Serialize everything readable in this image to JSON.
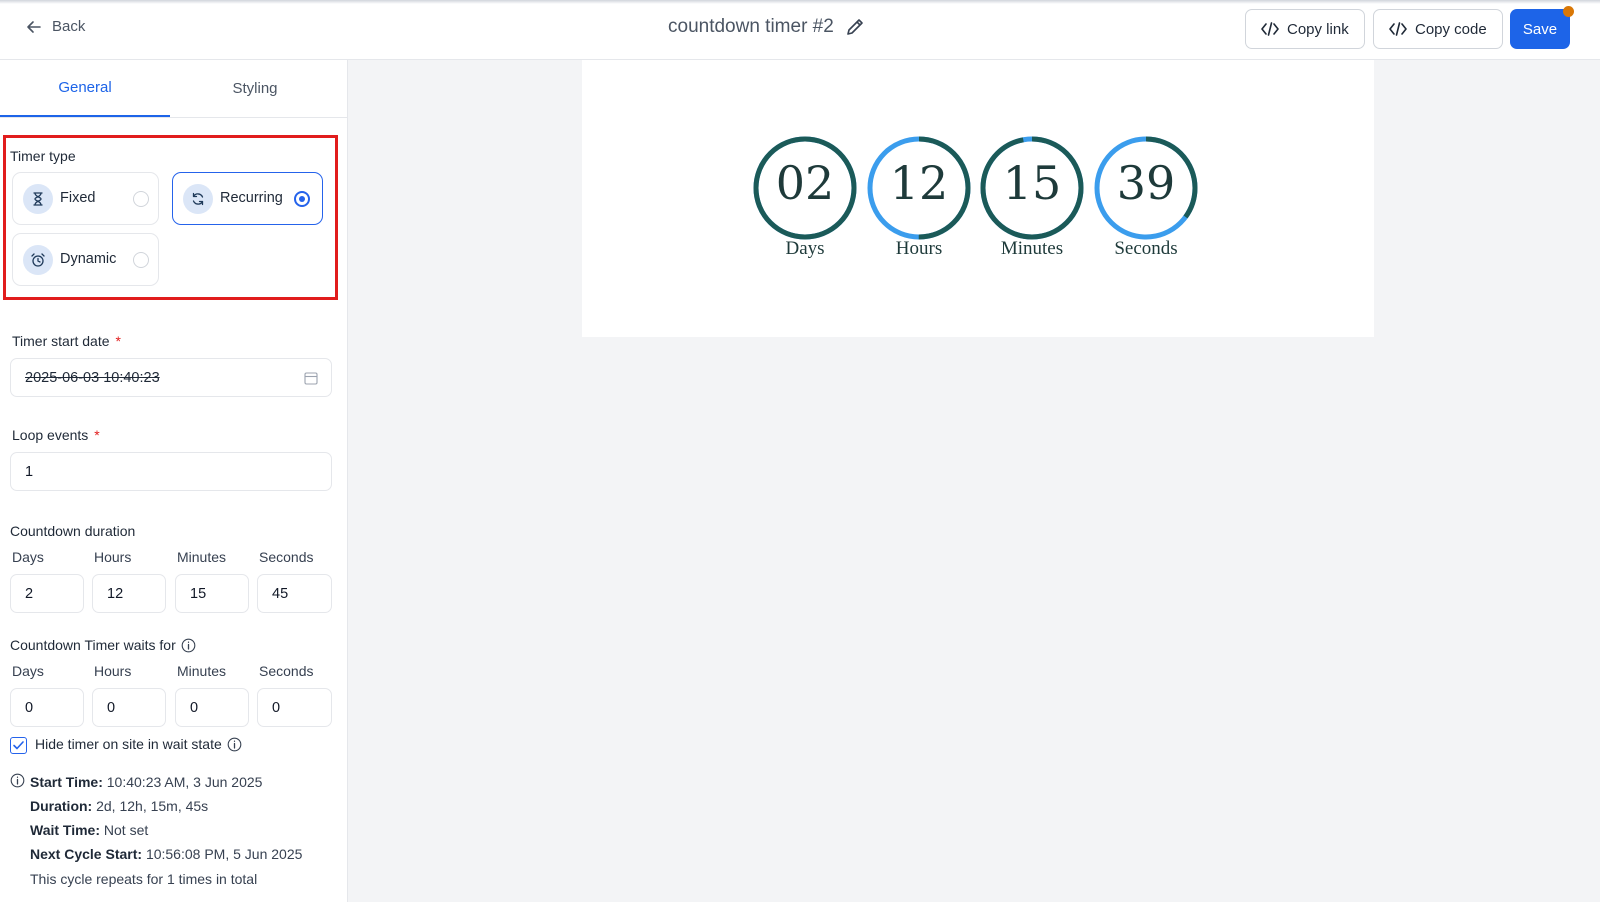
{
  "header": {
    "back_label": "Back",
    "title": "countdown timer #2",
    "copy_link_label": "Copy link",
    "copy_code_label": "Copy code",
    "save_label": "Save",
    "accent_color": "#1d64e8"
  },
  "tabs": [
    {
      "label": "General",
      "active": true
    },
    {
      "label": "Styling",
      "active": false
    }
  ],
  "timer_type": {
    "label": "Timer type",
    "options": [
      {
        "label": "Fixed",
        "icon": "hourglass-icon",
        "selected": false
      },
      {
        "label": "Recurring",
        "icon": "refresh-icon",
        "selected": true
      },
      {
        "label": "Dynamic",
        "icon": "alarm-clock-icon",
        "selected": false
      }
    ]
  },
  "start_date": {
    "label": "Timer start date",
    "required_mark": "*",
    "value": "2025-06-03 10:40:23"
  },
  "loop_events": {
    "label": "Loop events",
    "required_mark": "*",
    "value": "1"
  },
  "countdown_duration": {
    "label": "Countdown duration",
    "fields": [
      {
        "label": "Days",
        "value": "2"
      },
      {
        "label": "Hours",
        "value": "12"
      },
      {
        "label": "Minutes",
        "value": "15"
      },
      {
        "label": "Seconds",
        "value": "45"
      }
    ]
  },
  "wait_for": {
    "label": "Countdown Timer waits for",
    "fields": [
      {
        "label": "Days",
        "value": "0"
      },
      {
        "label": "Hours",
        "value": "0"
      },
      {
        "label": "Minutes",
        "value": "0"
      },
      {
        "label": "Seconds",
        "value": "0"
      }
    ]
  },
  "hide_timer": {
    "label": "Hide timer on site in wait state",
    "checked": true
  },
  "summary": {
    "start_time_label": "Start Time:",
    "start_time_value": "10:40:23 AM, 3 Jun 2025",
    "duration_label": "Duration:",
    "duration_value": "2d, 12h, 15m, 45s",
    "wait_time_label": "Wait Time:",
    "wait_time_value": "Not set",
    "next_cycle_label": "Next Cycle Start:",
    "next_cycle_value": "10:56:08 PM, 5 Jun 2025",
    "repeat_text": "This cycle repeats for 1 times in total"
  },
  "preview": {
    "units": [
      {
        "value": "02",
        "label": "Days",
        "progress": 1.0
      },
      {
        "value": "12",
        "label": "Hours",
        "progress": 0.5
      },
      {
        "value": "15",
        "label": "Minutes",
        "progress": 0.97
      },
      {
        "value": "39",
        "label": "Seconds",
        "progress": 0.35
      }
    ],
    "ring_dark_color": "#1b5a58",
    "ring_light_color": "#3b9ded"
  }
}
